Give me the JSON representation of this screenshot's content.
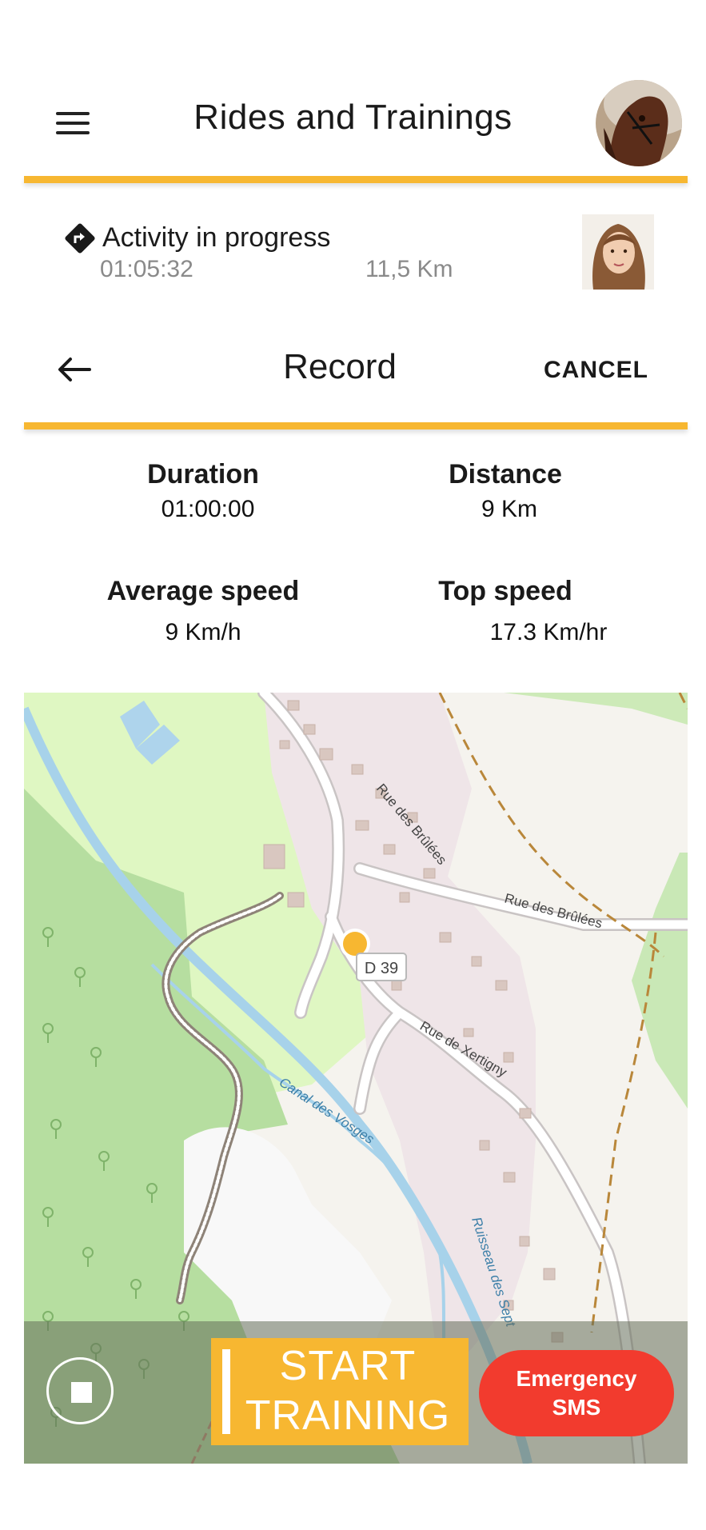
{
  "header": {
    "title": "Rides and Trainings"
  },
  "activity": {
    "label": "Activity in progress",
    "elapsed": "01:05:32",
    "distance": "11,5 Km"
  },
  "record": {
    "title": "Record",
    "cancel_label": "CANCEL"
  },
  "stats": {
    "duration_label": "Duration",
    "duration_value": "01:00:00",
    "distance_label": "Distance",
    "distance_value": "9 Km",
    "avg_speed_label": "Average speed",
    "avg_speed_value": "9 Km/h",
    "top_speed_label": "Top speed",
    "top_speed_value": "17.3 Km/hr"
  },
  "map": {
    "road_label_1": "Rue des Brûlées",
    "road_label_2": "Rue des Brûlées",
    "road_label_3": "Rue de Xertigny",
    "road_badge": "D 39",
    "canal_label": "Canal des Vosges",
    "stream_label": "Ruisseau des Sept"
  },
  "actions": {
    "start_line1": "START",
    "start_line2": "TRAINING",
    "sms_line1": "Emergency",
    "sms_line2": "SMS"
  },
  "colors": {
    "accent": "#f7b731",
    "emergency": "#f23b2e",
    "position_marker": "#f7b731"
  }
}
